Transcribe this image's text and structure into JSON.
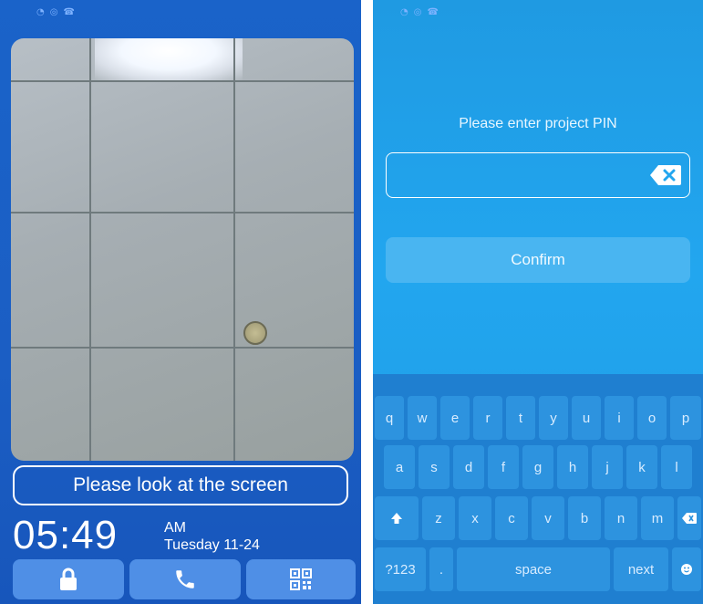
{
  "left_screen": {
    "notice_text": "Please look at the screen",
    "time": "05:49",
    "period": "AM",
    "date": "Tuesday 11-24",
    "buttons": [
      {
        "icon": "lock-icon"
      },
      {
        "icon": "phone-icon"
      },
      {
        "icon": "qr-code-icon"
      }
    ]
  },
  "right_screen": {
    "pin_prompt": "Please enter project PIN",
    "pin_value": "",
    "confirm_label": "Confirm",
    "keyboard": {
      "row1": [
        "q",
        "w",
        "e",
        "r",
        "t",
        "y",
        "u",
        "i",
        "o",
        "p"
      ],
      "row2": [
        "a",
        "s",
        "d",
        "f",
        "g",
        "h",
        "j",
        "k",
        "l"
      ],
      "row3": [
        "z",
        "x",
        "c",
        "v",
        "b",
        "n",
        "m"
      ],
      "row4": {
        "symbols": "?123",
        "period": ".",
        "space": "space",
        "next": "next"
      }
    }
  },
  "colors": {
    "left_bg": "#1a63c9",
    "right_bg": "#22a6ef",
    "keyboard_bg": "#1f7fd0"
  }
}
